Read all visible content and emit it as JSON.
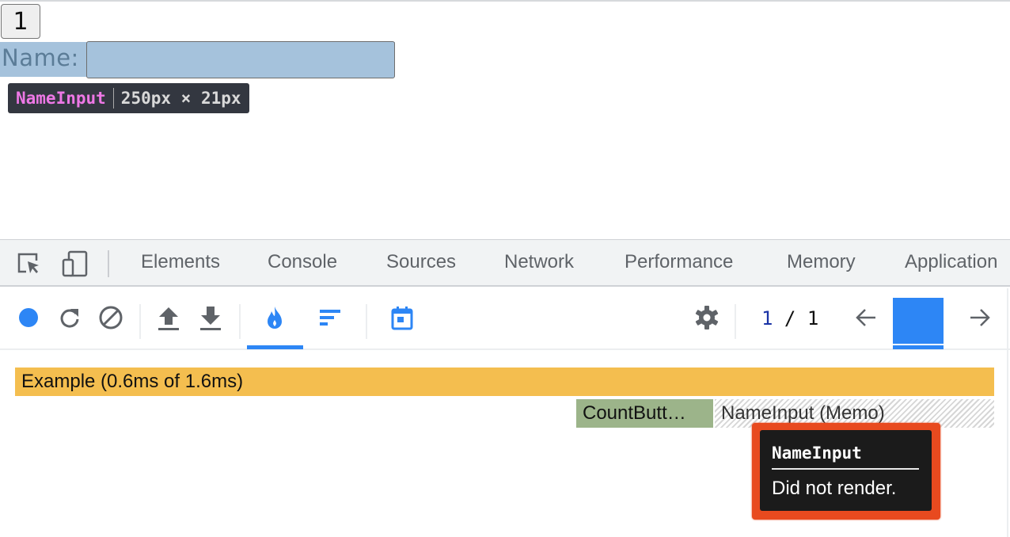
{
  "app": {
    "count_button_label": "1",
    "name_label": "Name:",
    "name_input_value": "",
    "inspect_tooltip": {
      "component": "NameInput",
      "size": "250px × 21px"
    }
  },
  "devtools": {
    "tabs": [
      "Elements",
      "Console",
      "Sources",
      "Network",
      "Performance",
      "Memory",
      "Application"
    ],
    "toolbar_icons": {
      "inspect": "inspect-element-icon",
      "device": "device-toolbar-icon",
      "record": "record-icon",
      "reload": "reload-and-profile-icon",
      "clear": "clear-icon",
      "load": "load-profile-icon",
      "save": "save-profile-icon",
      "flamegraph": "flamegraph-icon",
      "ranked": "ranked-chart-icon",
      "timeline": "timeline-icon",
      "settings": "settings-icon",
      "prev": "previous-commit-icon",
      "next": "next-commit-icon"
    },
    "commit": {
      "current": "1",
      "separator": "/",
      "total": "1"
    },
    "flamegraph": {
      "root": "Example (0.6ms of 1.6ms)",
      "children": [
        {
          "label": "CountButt…",
          "status": "rendered"
        },
        {
          "label": "NameInput (Memo)",
          "status": "did-not-render"
        }
      ]
    },
    "hover_tooltip": {
      "title": "NameInput",
      "message": "Did not render."
    },
    "colors": {
      "accent": "#2d86f5",
      "root_bar": "#f4be4f",
      "rendered_bar": "#9cb48a",
      "highlight": "#e84a1f"
    }
  }
}
